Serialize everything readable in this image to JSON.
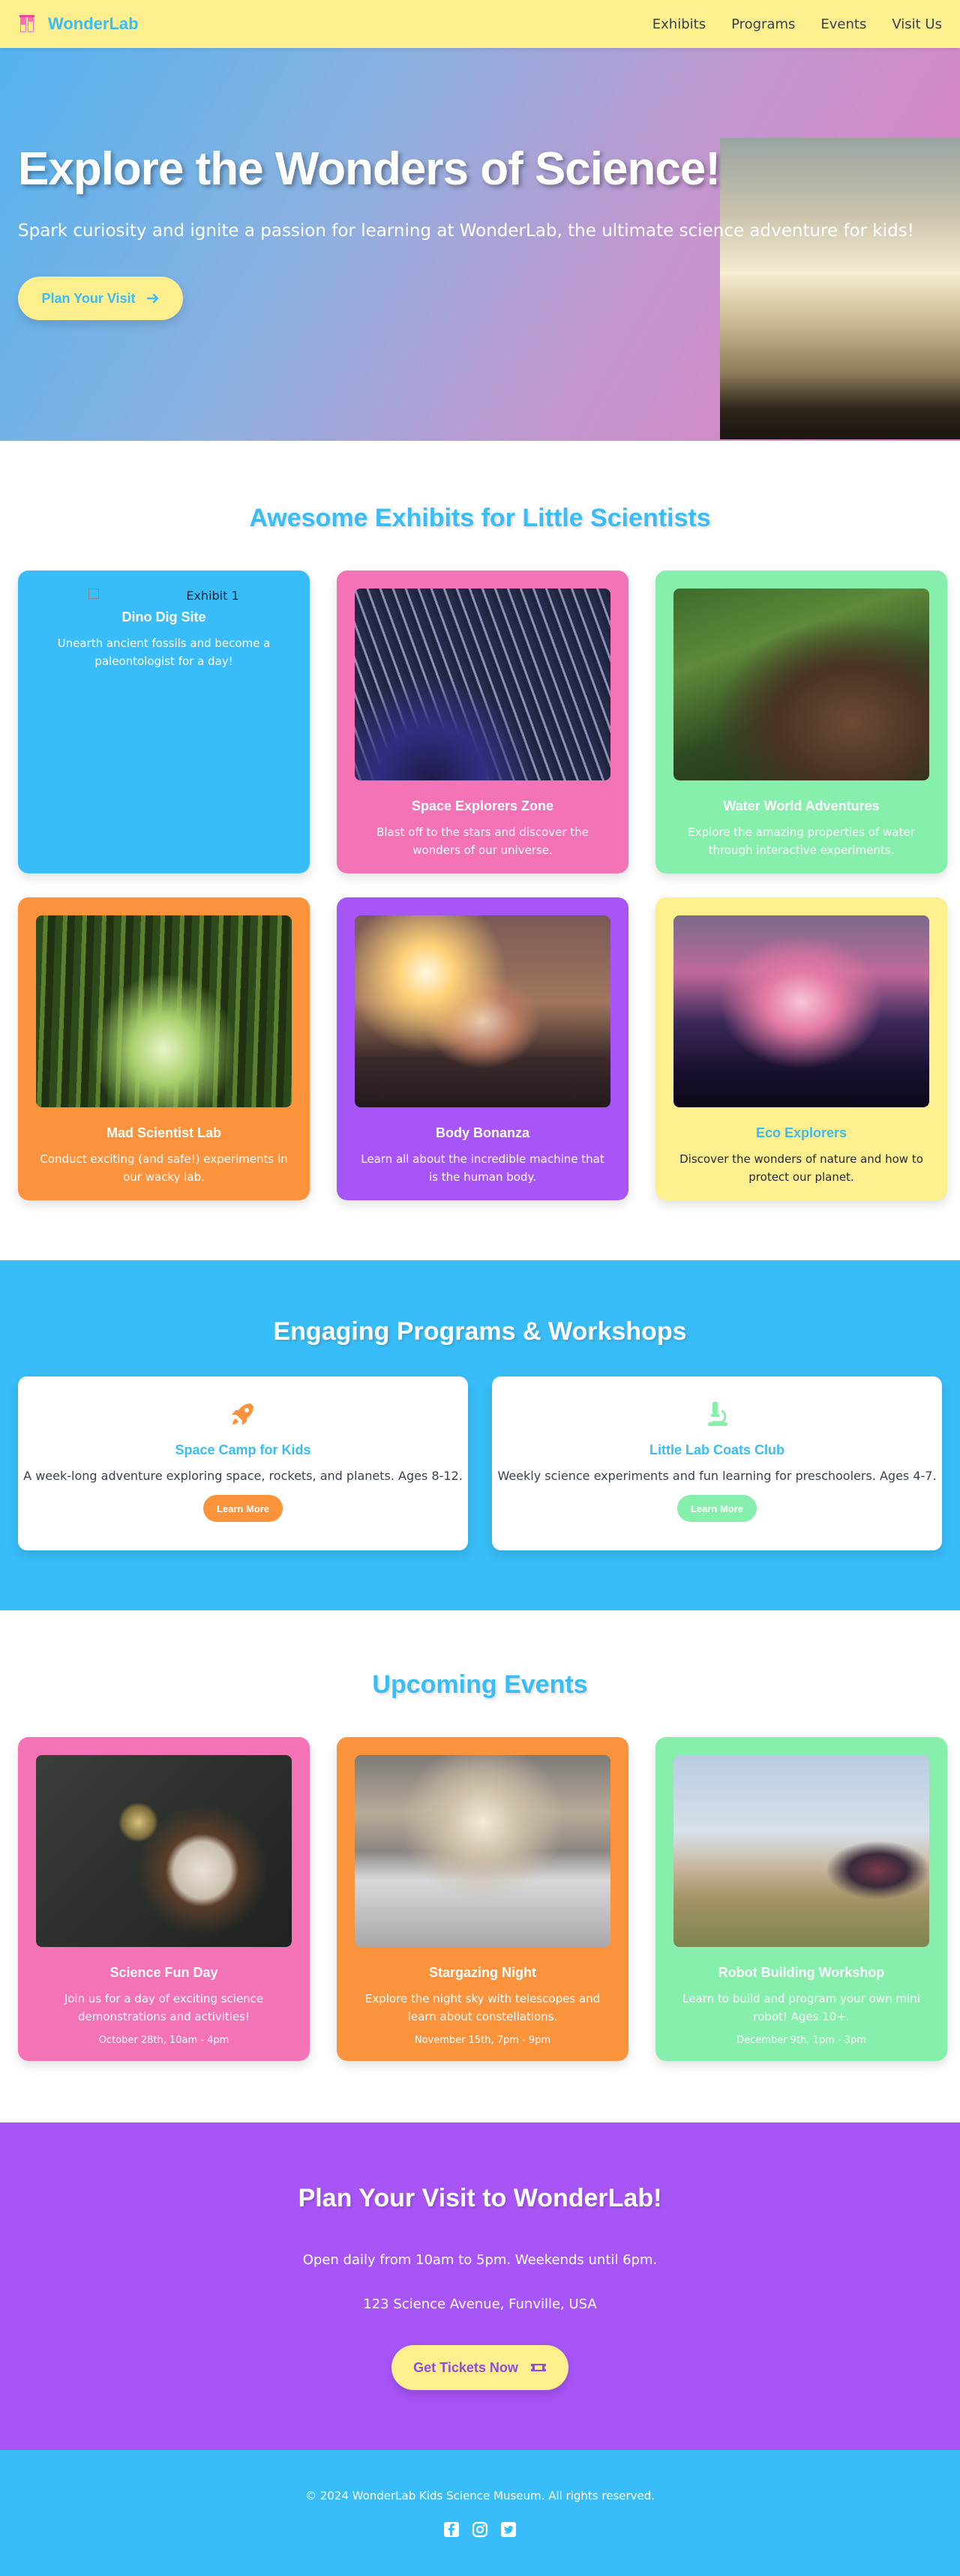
{
  "nav": {
    "brand": "WonderLab",
    "links": [
      "Exhibits",
      "Programs",
      "Events",
      "Visit Us"
    ]
  },
  "hero": {
    "title": "Explore the Wonders of Science!",
    "subtitle": "Spark curiosity and ignite a passion for learning at WonderLab, the ultimate science adventure for kids!",
    "button": "Plan Your Visit"
  },
  "exhibits": {
    "title": "Awesome Exhibits for Little Scientists",
    "items": [
      {
        "alt": "Exhibit 1",
        "title": "Dino Dig Site",
        "desc": "Unearth ancient fossils and become a paleontologist for a day!",
        "color": "#38bdf8"
      },
      {
        "title": "Space Explorers Zone",
        "desc": "Blast off to the stars and discover the wonders of our universe.",
        "color": "#f472b6"
      },
      {
        "title": "Water World Adventures",
        "desc": "Explore the amazing properties of water through interactive experiments.",
        "color": "#86efac"
      },
      {
        "title": "Mad Scientist Lab",
        "desc": "Conduct exciting (and safe!) experiments in our wacky lab.",
        "color": "#fb923c"
      },
      {
        "title": "Body Bonanza",
        "desc": "Learn all about the incredible machine that is the human body.",
        "color": "#a855f7"
      },
      {
        "title": "Eco Explorers",
        "desc": "Discover the wonders of nature and how to protect our planet.",
        "color": "#fdee8e"
      }
    ]
  },
  "programs": {
    "title": "Engaging Programs & Workshops",
    "items": [
      {
        "title": "Space Camp for Kids",
        "desc": "A week-long adventure exploring space, rockets, and planets. Ages 8-12.",
        "button": "Learn More",
        "icon": "rocket-icon",
        "color": "#fb923c"
      },
      {
        "title": "Little Lab Coats Club",
        "desc": "Weekly science experiments and fun learning for preschoolers. Ages 4-7.",
        "button": "Learn More",
        "icon": "microscope-icon",
        "color": "#86efac"
      }
    ]
  },
  "events": {
    "title": "Upcoming Events",
    "items": [
      {
        "title": "Science Fun Day",
        "desc": "Join us for a day of exciting science demonstrations and activities!",
        "date": "October 28th, 10am - 4pm",
        "color": "#f472b6"
      },
      {
        "title": "Stargazing Night",
        "desc": "Explore the night sky with telescopes and learn about constellations.",
        "date": "November 15th, 7pm - 9pm",
        "color": "#fb923c"
      },
      {
        "title": "Robot Building Workshop",
        "desc": "Learn to build and program your own mini robot! Ages 10+.",
        "date": "December 9th, 1pm - 3pm",
        "color": "#86efac"
      }
    ]
  },
  "visit": {
    "title": "Plan Your Visit to WonderLab!",
    "hours": "Open daily from 10am to 5pm. Weekends until 6pm.",
    "address": "123 Science Avenue, Funville, USA",
    "button": "Get Tickets Now"
  },
  "footer": {
    "text": "© 2024 WonderLab Kids Science Museum. All rights reserved.",
    "social": [
      "facebook-icon",
      "instagram-icon",
      "twitter-icon"
    ]
  }
}
